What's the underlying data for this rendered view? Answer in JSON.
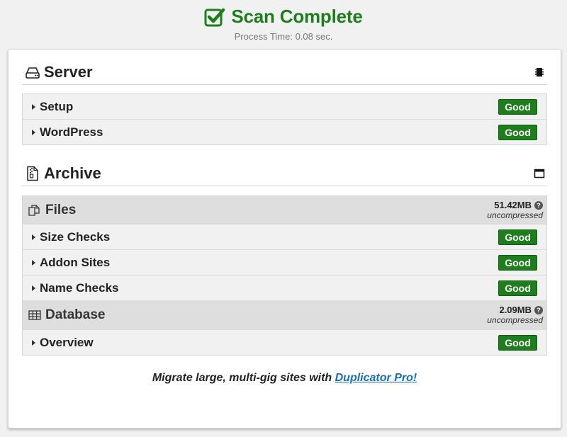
{
  "header": {
    "title": "Scan Complete",
    "process_time": "Process Time: 0.08 sec.",
    "accent_color": "#1e7e1e"
  },
  "server": {
    "title": "Server",
    "icon": "hdd-icon",
    "right_icon": "chip-icon",
    "rows": [
      {
        "label": "Setup",
        "status": "Good"
      },
      {
        "label": "WordPress",
        "status": "Good"
      }
    ]
  },
  "archive": {
    "title": "Archive",
    "icon": "zip-file-icon",
    "right_icon": "window-icon",
    "files": {
      "title": "Files",
      "size": "51.42MB",
      "size_note": "uncompressed",
      "rows": [
        {
          "label": "Size Checks",
          "status": "Good"
        },
        {
          "label": "Addon Sites",
          "status": "Good"
        },
        {
          "label": "Name Checks",
          "status": "Good"
        }
      ]
    },
    "database": {
      "title": "Database",
      "size": "2.09MB",
      "size_note": "uncompressed",
      "rows": [
        {
          "label": "Overview",
          "status": "Good"
        }
      ]
    }
  },
  "promo": {
    "text": "Migrate large, multi-gig sites with ",
    "link": "Duplicator Pro!",
    "link_color": "#1a6fb8"
  }
}
